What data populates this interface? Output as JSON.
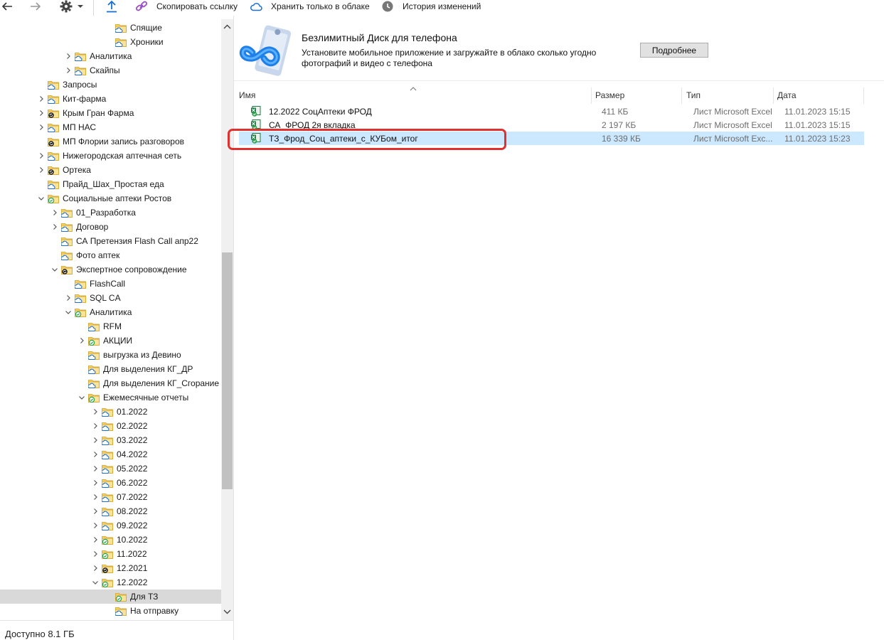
{
  "toolbar": {
    "copy_link": "Скопировать ссылку",
    "cloud_only": "Хранить только в облаке",
    "history": "История изменений"
  },
  "tree": [
    {
      "label": "Спящие",
      "level": 7,
      "chev": "none",
      "status": "cloud"
    },
    {
      "label": "Хроники",
      "level": 7,
      "chev": "none",
      "status": "cloud"
    },
    {
      "label": "Аналитика",
      "level": 4,
      "chev": "right",
      "status": "cloud"
    },
    {
      "label": "Скайпы",
      "level": 4,
      "chev": "right",
      "status": "cloud"
    },
    {
      "label": "Запросы",
      "level": 2,
      "chev": "none",
      "status": "cloud"
    },
    {
      "label": "Кит-фарма",
      "level": 2,
      "chev": "right",
      "status": "cloud"
    },
    {
      "label": "Крым Гран Фарма",
      "level": 2,
      "chev": "right",
      "status": "sync"
    },
    {
      "label": "МП НАС",
      "level": 2,
      "chev": "right",
      "status": "cloud"
    },
    {
      "label": "МП Флории запись разговоров",
      "level": 2,
      "chev": "none",
      "status": "sync"
    },
    {
      "label": "Нижегородская аптечная сеть",
      "level": 2,
      "chev": "right",
      "status": "cloud"
    },
    {
      "label": "Ортека",
      "level": 2,
      "chev": "right",
      "status": "sync"
    },
    {
      "label": "Прайд_Шах_Простая еда",
      "level": 2,
      "chev": "none",
      "status": "cloud"
    },
    {
      "label": "Социальные аптеки Ростов",
      "level": 2,
      "chev": "down",
      "status": "check"
    },
    {
      "label": "01_Разработка",
      "level": 3,
      "chev": "right",
      "status": "cloud"
    },
    {
      "label": "Договор",
      "level": 3,
      "chev": "right",
      "status": "cloud"
    },
    {
      "label": "СА Претензия Flash Call апр22",
      "level": 3,
      "chev": "none",
      "status": "cloud"
    },
    {
      "label": "Фото аптек",
      "level": 3,
      "chev": "none",
      "status": "cloud"
    },
    {
      "label": "Экспертное сопровождение",
      "level": 3,
      "chev": "down",
      "status": "sync"
    },
    {
      "label": "FlashCall",
      "level": 4,
      "chev": "none",
      "status": "cloud"
    },
    {
      "label": "SQL CA",
      "level": 4,
      "chev": "right",
      "status": "cloud"
    },
    {
      "label": "Аналитика",
      "level": 4,
      "chev": "down",
      "status": "check"
    },
    {
      "label": "RFM",
      "level": 5,
      "chev": "none",
      "status": "cloud"
    },
    {
      "label": "АКЦИИ",
      "level": 5,
      "chev": "right",
      "status": "check"
    },
    {
      "label": "выгрузка из Девино",
      "level": 5,
      "chev": "none",
      "status": "cloud"
    },
    {
      "label": "Для выделения КГ_ДР",
      "level": 5,
      "chev": "none",
      "status": "cloud"
    },
    {
      "label": "Для выделения КГ_Сгорание",
      "level": 5,
      "chev": "none",
      "status": "cloud"
    },
    {
      "label": "Ежемесячные отчеты",
      "level": 5,
      "chev": "down",
      "status": "check"
    },
    {
      "label": "01.2022",
      "level": 6,
      "chev": "right",
      "status": "cloud"
    },
    {
      "label": "02.2022",
      "level": 6,
      "chev": "right",
      "status": "cloud"
    },
    {
      "label": "03.2022",
      "level": 6,
      "chev": "right",
      "status": "cloud"
    },
    {
      "label": "04.2022",
      "level": 6,
      "chev": "right",
      "status": "cloud"
    },
    {
      "label": "05.2022",
      "level": 6,
      "chev": "right",
      "status": "cloud"
    },
    {
      "label": "06.2022",
      "level": 6,
      "chev": "right",
      "status": "cloud"
    },
    {
      "label": "07.2022",
      "level": 6,
      "chev": "right",
      "status": "cloud"
    },
    {
      "label": "08.2022",
      "level": 6,
      "chev": "right",
      "status": "cloud"
    },
    {
      "label": "09.2022",
      "level": 6,
      "chev": "right",
      "status": "cloud"
    },
    {
      "label": "10.2022",
      "level": 6,
      "chev": "right",
      "status": "check"
    },
    {
      "label": "11.2022",
      "level": 6,
      "chev": "right",
      "status": "check"
    },
    {
      "label": "12.2021",
      "level": 6,
      "chev": "right",
      "status": "sync"
    },
    {
      "label": "12.2022",
      "level": 6,
      "chev": "down",
      "status": "check"
    },
    {
      "label": "Для ТЗ",
      "level": 7,
      "chev": "none",
      "status": "check",
      "selected": true
    },
    {
      "label": "На отправку",
      "level": 7,
      "chev": "none",
      "status": "cloud"
    }
  ],
  "status_bar": {
    "free_space": "Доступно 8.1 ГБ"
  },
  "promo": {
    "title": "Безлимитный Диск для телефона",
    "text": "Установите мобильное приложение и загружайте в облако сколько угодно фотографий и видео с телефона",
    "button": "Подробнее"
  },
  "columns": {
    "name": "Имя",
    "size": "Размер",
    "type": "Тип",
    "date": "Дата"
  },
  "files": [
    {
      "name": "12.2022 СоцАптеки ФРОД",
      "size": "411 КБ",
      "type": "Лист Microsoft Excel",
      "date": "11.01.2023 15:15",
      "status": "check",
      "selected": false
    },
    {
      "name": "СА_ФРОД 2я вкладка",
      "size": "2 197 КБ",
      "type": "Лист Microsoft Excel",
      "date": "11.01.2023 15:15",
      "status": "check",
      "selected": false
    },
    {
      "name": "ТЗ_Фрод_Соц_аптеки_с_КУБом_итог",
      "size": "16 339 КБ",
      "type": "Лист Microsoft Exc...",
      "date": "11.01.2023 15:23",
      "status": "check",
      "selected": true
    }
  ],
  "colors": {
    "selection": "#cce8ff",
    "highlight": "#e0312f",
    "folder": "#f8d775",
    "check": "#2ea44f",
    "cloud": "#1a6fd4"
  }
}
